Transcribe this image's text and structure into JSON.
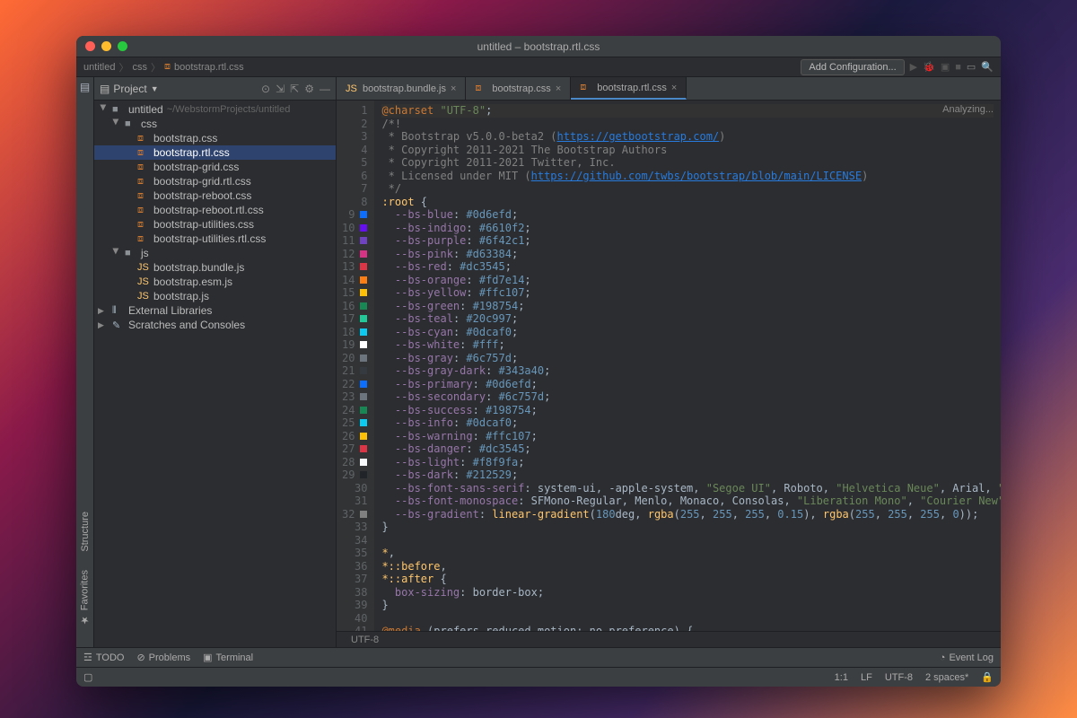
{
  "window_title": "untitled – bootstrap.rtl.css",
  "breadcrumb": {
    "root": "untitled",
    "folder": "css",
    "file": "bootstrap.rtl.css"
  },
  "add_config": "Add Configuration...",
  "project_label": "Project",
  "panel": {
    "title": "Project"
  },
  "tree": [
    {
      "depth": 0,
      "name": "untitled",
      "suffix": "~/WebstormProjects/untitled",
      "icon": "folder",
      "open": true
    },
    {
      "depth": 1,
      "name": "css",
      "icon": "folder",
      "open": true
    },
    {
      "depth": 2,
      "name": "bootstrap.css",
      "icon": "css"
    },
    {
      "depth": 2,
      "name": "bootstrap.rtl.css",
      "icon": "css",
      "selected": true
    },
    {
      "depth": 2,
      "name": "bootstrap-grid.css",
      "icon": "css"
    },
    {
      "depth": 2,
      "name": "bootstrap-grid.rtl.css",
      "icon": "css"
    },
    {
      "depth": 2,
      "name": "bootstrap-reboot.css",
      "icon": "css"
    },
    {
      "depth": 2,
      "name": "bootstrap-reboot.rtl.css",
      "icon": "css"
    },
    {
      "depth": 2,
      "name": "bootstrap-utilities.css",
      "icon": "css"
    },
    {
      "depth": 2,
      "name": "bootstrap-utilities.rtl.css",
      "icon": "css"
    },
    {
      "depth": 1,
      "name": "js",
      "icon": "folder",
      "open": true
    },
    {
      "depth": 2,
      "name": "bootstrap.bundle.js",
      "icon": "js"
    },
    {
      "depth": 2,
      "name": "bootstrap.esm.js",
      "icon": "js"
    },
    {
      "depth": 2,
      "name": "bootstrap.js",
      "icon": "js"
    },
    {
      "depth": 0,
      "name": "External Libraries",
      "icon": "lib"
    },
    {
      "depth": 0,
      "name": "Scratches and Consoles",
      "icon": "scratch"
    }
  ],
  "tabs": [
    {
      "name": "bootstrap.bundle.js",
      "icon": "js"
    },
    {
      "name": "bootstrap.css",
      "icon": "css"
    },
    {
      "name": "bootstrap.rtl.css",
      "icon": "css",
      "active": true
    }
  ],
  "editor": {
    "overlay": "Analyzing...",
    "crumb": "UTF-8",
    "lines": [
      {
        "n": 1,
        "m": null,
        "html": "<span class='kw'>@charset</span> <span class='str'>\"UTF-8\"</span>;"
      },
      {
        "n": 2,
        "m": null,
        "html": "<span class='cmt'>/*!</span>"
      },
      {
        "n": 3,
        "m": null,
        "html": "<span class='cmt'> * Bootstrap v5.0.0-beta2 (</span><span class='url'>https://getbootstrap.com/</span><span class='cmt'>)</span>"
      },
      {
        "n": 4,
        "m": null,
        "html": "<span class='cmt'> * Copyright 2011-2021 The Bootstrap Authors</span>"
      },
      {
        "n": 5,
        "m": null,
        "html": "<span class='cmt'> * Copyright 2011-2021 Twitter, Inc.</span>"
      },
      {
        "n": 6,
        "m": null,
        "html": "<span class='cmt'> * Licensed under MIT (</span><span class='url'>https://github.com/twbs/bootstrap/blob/main/LICENSE</span><span class='cmt'>)</span>"
      },
      {
        "n": 7,
        "m": null,
        "html": "<span class='cmt'> */</span>"
      },
      {
        "n": 8,
        "m": null,
        "html": "<span class='sel'>:root</span> {"
      },
      {
        "n": 9,
        "m": "#0d6efd",
        "html": "  <span class='prop'>--bs-blue</span>: <span class='hex'>#0d6efd</span>;"
      },
      {
        "n": 10,
        "m": "#6610f2",
        "html": "  <span class='prop'>--bs-indigo</span>: <span class='hex'>#6610f2</span>;"
      },
      {
        "n": 11,
        "m": "#6f42c1",
        "html": "  <span class='prop'>--bs-purple</span>: <span class='hex'>#6f42c1</span>;"
      },
      {
        "n": 12,
        "m": "#d63384",
        "html": "  <span class='prop'>--bs-pink</span>: <span class='hex'>#d63384</span>;"
      },
      {
        "n": 13,
        "m": "#dc3545",
        "html": "  <span class='prop'>--bs-red</span>: <span class='hex'>#dc3545</span>;"
      },
      {
        "n": 14,
        "m": "#fd7e14",
        "html": "  <span class='prop'>--bs-orange</span>: <span class='hex'>#fd7e14</span>;"
      },
      {
        "n": 15,
        "m": "#ffc107",
        "html": "  <span class='prop'>--bs-yellow</span>: <span class='hex'>#ffc107</span>;"
      },
      {
        "n": 16,
        "m": "#198754",
        "html": "  <span class='prop'>--bs-green</span>: <span class='hex'>#198754</span>;"
      },
      {
        "n": 17,
        "m": "#20c997",
        "html": "  <span class='prop'>--bs-teal</span>: <span class='hex'>#20c997</span>;"
      },
      {
        "n": 18,
        "m": "#0dcaf0",
        "html": "  <span class='prop'>--bs-cyan</span>: <span class='hex'>#0dcaf0</span>;"
      },
      {
        "n": 19,
        "m": "#ffffff",
        "html": "  <span class='prop'>--bs-white</span>: <span class='hex'>#fff</span>;"
      },
      {
        "n": 20,
        "m": "#6c757d",
        "html": "  <span class='prop'>--bs-gray</span>: <span class='hex'>#6c757d</span>;"
      },
      {
        "n": 21,
        "m": "#343a40",
        "html": "  <span class='prop'>--bs-gray-dark</span>: <span class='hex'>#343a40</span>;"
      },
      {
        "n": 22,
        "m": "#0d6efd",
        "html": "  <span class='prop'>--bs-primary</span>: <span class='hex'>#0d6efd</span>;"
      },
      {
        "n": 23,
        "m": "#6c757d",
        "html": "  <span class='prop'>--bs-secondary</span>: <span class='hex'>#6c757d</span>;"
      },
      {
        "n": 24,
        "m": "#198754",
        "html": "  <span class='prop'>--bs-success</span>: <span class='hex'>#198754</span>;"
      },
      {
        "n": 25,
        "m": "#0dcaf0",
        "html": "  <span class='prop'>--bs-info</span>: <span class='hex'>#0dcaf0</span>;"
      },
      {
        "n": 26,
        "m": "#ffc107",
        "html": "  <span class='prop'>--bs-warning</span>: <span class='hex'>#ffc107</span>;"
      },
      {
        "n": 27,
        "m": "#dc3545",
        "html": "  <span class='prop'>--bs-danger</span>: <span class='hex'>#dc3545</span>;"
      },
      {
        "n": 28,
        "m": "#f8f9fa",
        "html": "  <span class='prop'>--bs-light</span>: <span class='hex'>#f8f9fa</span>;"
      },
      {
        "n": 29,
        "m": "#212529",
        "html": "  <span class='prop'>--bs-dark</span>: <span class='hex'>#212529</span>;"
      },
      {
        "n": 30,
        "m": null,
        "html": "  <span class='prop'>--bs-font-sans-serif</span>: <span class='id'>system-ui</span>, <span class='id'>-apple-system</span>, <span class='str'>\"Segoe UI\"</span>, <span class='id'>Roboto</span>, <span class='str'>\"Helvetica Neue\"</span>, <span class='id'>Arial</span>, <span class='str'>\"Noto Sans\"</span>, <span class='str'>\"Libera</span>"
      },
      {
        "n": 31,
        "m": null,
        "html": "  <span class='prop'>--bs-font-monospace</span>: <span class='id'>SFMono-Regular</span>, <span class='id'>Menlo</span>, <span class='id'>Monaco</span>, <span class='id'>Consolas</span>, <span class='str'>\"Liberation Mono\"</span>, <span class='str'>\"Courier New\"</span>, <span class='id'>monospace</span>;"
      },
      {
        "n": 32,
        "m": "#808080",
        "html": "  <span class='prop'>--bs-gradient</span>: <span class='fn'>linear-gradient</span>(<span class='num'>180</span><span class='id'>deg</span>, <span class='fn'>rgba</span>(<span class='num'>255</span>, <span class='num'>255</span>, <span class='num'>255</span>, <span class='num'>0.15</span>), <span class='fn'>rgba</span>(<span class='num'>255</span>, <span class='num'>255</span>, <span class='num'>255</span>, <span class='num'>0</span>));"
      },
      {
        "n": 33,
        "m": null,
        "html": "}"
      },
      {
        "n": 34,
        "m": null,
        "html": "&nbsp;"
      },
      {
        "n": 35,
        "m": null,
        "html": "<span class='sel'>*</span>,"
      },
      {
        "n": 36,
        "m": null,
        "html": "<span class='sel'>*::before</span>,"
      },
      {
        "n": 37,
        "m": null,
        "html": "<span class='sel'>*::after</span> {"
      },
      {
        "n": 38,
        "m": null,
        "html": "  <span class='prop'>box-sizing</span>: <span class='id'>border-box</span>;"
      },
      {
        "n": 39,
        "m": null,
        "html": "}"
      },
      {
        "n": 40,
        "m": null,
        "html": "&nbsp;"
      },
      {
        "n": 41,
        "m": null,
        "html": "<span class='kw'>@media</span> (<span class='id'>prefers-reduced-motion</span>: <span class='id'>no-preference</span>) {"
      }
    ]
  },
  "left_tools": [
    "Structure",
    "Favorites"
  ],
  "bottom_tools": {
    "todo": "TODO",
    "problems": "Problems",
    "terminal": "Terminal",
    "event_log": "Event Log"
  },
  "status": {
    "pos": "1:1",
    "le": "LF",
    "enc": "UTF-8",
    "indent": "2 spaces*"
  }
}
